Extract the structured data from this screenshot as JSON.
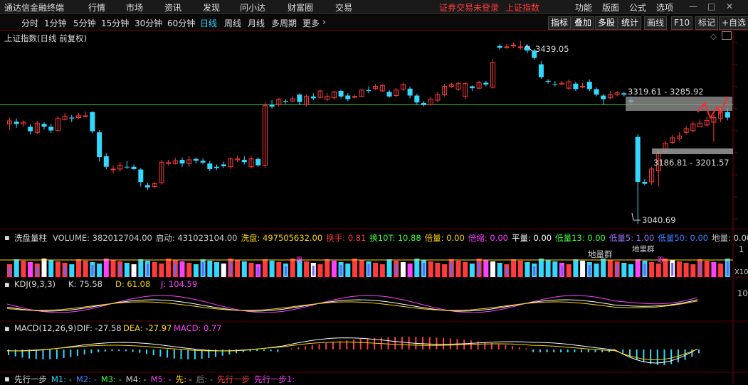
{
  "menubar": {
    "app_title": "通达信金融终端",
    "items": [
      "行情",
      "市场",
      "资讯",
      "发现",
      "问小达",
      "财富圈",
      "交易"
    ],
    "notice": "证券交易未登录",
    "current_index": "上证指数",
    "right_items": [
      "功能",
      "版面",
      "公式",
      "选项"
    ]
  },
  "toolbar": {
    "timeframes": [
      "分时",
      "1分钟",
      "5分钟",
      "15分钟",
      "30分钟",
      "60分钟",
      "日线",
      "周线",
      "月线",
      "多周期",
      "更多"
    ],
    "active": "日线",
    "tools": [
      "指标",
      "叠加",
      "多股",
      "统计",
      "画线",
      "F10",
      "标记",
      "+自选"
    ],
    "active_tools": [
      "指标",
      "叠加",
      "多股",
      "统计"
    ]
  },
  "main_chart": {
    "title": "上证指数(日线 前复权)",
    "annotations": {
      "high": "3439.05",
      "range_upper": "3319.61 - 3285.92",
      "range_lower": "3186.81 - 3201.57",
      "low": "3040.69"
    }
  },
  "volume_panel": {
    "indicator": "洗盘量柱",
    "fields": [
      {
        "text": "VOLUME: 382012704.00",
        "color": "#cccccc"
      },
      {
        "text": "启动: 431023104.00",
        "color": "#cccccc"
      },
      {
        "text": "洗盘: 497505632.00",
        "color": "#ffd700"
      },
      {
        "text": "换手: 0.81",
        "color": "#ff3b3b"
      },
      {
        "text": "换10T: 10.88",
        "color": "#3bff3b"
      },
      {
        "text": "倍量: 0.00",
        "color": "#ffd700"
      },
      {
        "text": "倍缩: 0.00",
        "color": "#ff40ff"
      },
      {
        "text": "平量: 0.00",
        "color": "#ffffff"
      },
      {
        "text": "低量13: 0.00",
        "color": "#3bff3b"
      },
      {
        "text": "低量5: 1.00",
        "color": "#a070ff"
      },
      {
        "text": "低量50: 0.00",
        "color": "#4080ff"
      },
      {
        "text": "地量: 0.00",
        "color": "#cccccc"
      },
      {
        "text": "地",
        "color": "#a070ff"
      }
    ],
    "labels": {
      "digeqiao_1": "地量群",
      "digeqiao_2": "地里群",
      "small_tag": "跟"
    },
    "axis": {
      "top": "1",
      "bottom": "X10"
    }
  },
  "kdj_panel": {
    "name": "KDJ(9,3,3)",
    "k": "K: 75.58",
    "d": "D: 61.08",
    "j": "J: 104.59",
    "axis": {
      "top": "10"
    }
  },
  "macd_panel": {
    "name": "MACD(12,26,9)",
    "dif": "DIF: -27.58",
    "dea": "DEA: -27.97",
    "macd": "MACD: 0.77"
  },
  "bottom_panel": {
    "name": "先行一步",
    "fields": [
      {
        "text": "M1: -",
        "color": "#34d8ff"
      },
      {
        "text": "M2: -",
        "color": "#4080ff"
      },
      {
        "text": "M3: -",
        "color": "#3bff3b"
      },
      {
        "text": "M4: -",
        "color": "#cccccc"
      },
      {
        "text": "M5: -",
        "color": "#ff40ff"
      },
      {
        "text": "先: -",
        "color": "#ffd700"
      },
      {
        "text": "后: -",
        "color": "#888888"
      },
      {
        "text": "先行一步",
        "color": "#ff3b3b"
      },
      {
        "text": "先行一步1:",
        "color": "#ff40ff"
      }
    ]
  },
  "colors": {
    "up": "#ff3b3b",
    "down": "#34d8ff",
    "bg": "#000000",
    "grid": "#7a0000",
    "ma_line": "#2eb82e"
  },
  "chart_data": {
    "type": "candlestick",
    "ylim": [
      3030,
      3460
    ],
    "reference_line": 3300,
    "candles": [
      [
        3258,
        3265,
        3245,
        3272
      ],
      [
        3263,
        3258,
        3250,
        3270
      ],
      [
        3258,
        3262,
        3252,
        3266
      ],
      [
        3252,
        3242,
        3235,
        3258
      ],
      [
        3240,
        3260,
        3236,
        3265
      ],
      [
        3258,
        3252,
        3246,
        3262
      ],
      [
        3252,
        3244,
        3238,
        3258
      ],
      [
        3244,
        3270,
        3242,
        3275
      ],
      [
        3268,
        3275,
        3266,
        3282
      ],
      [
        3272,
        3270,
        3262,
        3278
      ],
      [
        3272,
        3276,
        3268,
        3282
      ],
      [
        3275,
        3276,
        3272,
        3285
      ],
      [
        3284,
        3242,
        3238,
        3286
      ],
      [
        3240,
        3186,
        3176,
        3245
      ],
      [
        3188,
        3165,
        3160,
        3195
      ],
      [
        3160,
        3160,
        3150,
        3168
      ],
      [
        3160,
        3168,
        3154,
        3175
      ],
      [
        3165,
        3164,
        3160,
        3178
      ],
      [
        3165,
        3160,
        3158,
        3170
      ],
      [
        3159,
        3132,
        3122,
        3162
      ],
      [
        3125,
        3120,
        3114,
        3130
      ],
      [
        3122,
        3128,
        3118,
        3132
      ],
      [
        3130,
        3175,
        3126,
        3180
      ],
      [
        3172,
        3174,
        3168,
        3180
      ],
      [
        3172,
        3178,
        3170,
        3185
      ],
      [
        3180,
        3172,
        3165,
        3185
      ],
      [
        3172,
        3180,
        3165,
        3188
      ],
      [
        3182,
        3178,
        3172,
        3185
      ],
      [
        3178,
        3174,
        3170,
        3183
      ],
      [
        3172,
        3160,
        3155,
        3178
      ],
      [
        3165,
        3162,
        3158,
        3170
      ],
      [
        3170,
        3166,
        3162,
        3176
      ],
      [
        3165,
        3182,
        3160,
        3185
      ],
      [
        3180,
        3182,
        3175,
        3190
      ],
      [
        3180,
        3175,
        3170,
        3188
      ],
      [
        3165,
        3182,
        3162,
        3188
      ],
      [
        3182,
        3168,
        3165,
        3185
      ],
      [
        3168,
        3298,
        3162,
        3305
      ],
      [
        3300,
        3296,
        3292,
        3310
      ],
      [
        3300,
        3312,
        3296,
        3315
      ],
      [
        3308,
        3306,
        3302,
        3312
      ],
      [
        3308,
        3313,
        3305,
        3318
      ],
      [
        3322,
        3306,
        3300,
        3325
      ],
      [
        3300,
        3318,
        3296,
        3322
      ],
      [
        3318,
        3314,
        3310,
        3325
      ],
      [
        3316,
        3330,
        3314,
        3333
      ],
      [
        3312,
        3318,
        3308,
        3325
      ],
      [
        3315,
        3328,
        3312,
        3330
      ],
      [
        3330,
        3318,
        3314,
        3333
      ],
      [
        3320,
        3312,
        3308,
        3325
      ],
      [
        3318,
        3318,
        3314,
        3322
      ],
      [
        3318,
        3332,
        3316,
        3335
      ],
      [
        3332,
        3330,
        3325,
        3340
      ],
      [
        3335,
        3340,
        3332,
        3345
      ],
      [
        3330,
        3342,
        3328,
        3345
      ],
      [
        3328,
        3318,
        3315,
        3332
      ],
      [
        3320,
        3332,
        3316,
        3336
      ],
      [
        3334,
        3344,
        3330,
        3348
      ],
      [
        3335,
        3320,
        3314,
        3340
      ],
      [
        3320,
        3305,
        3300,
        3324
      ],
      [
        3304,
        3300,
        3296,
        3308
      ],
      [
        3300,
        3312,
        3298,
        3318
      ],
      [
        3310,
        3322,
        3305,
        3328
      ],
      [
        3322,
        3340,
        3318,
        3345
      ],
      [
        3340,
        3344,
        3336,
        3348
      ],
      [
        3334,
        3346,
        3330,
        3350
      ],
      [
        3318,
        3346,
        3312,
        3350
      ],
      [
        3340,
        3336,
        3330,
        3342
      ],
      [
        3336,
        3348,
        3334,
        3352
      ],
      [
        3348,
        3344,
        3340,
        3352
      ],
      [
        3338,
        3392,
        3335,
        3400
      ],
      [
        3428,
        3424,
        3420,
        3432
      ],
      [
        3426,
        3426,
        3422,
        3432
      ],
      [
        3428,
        3430,
        3424,
        3436
      ],
      [
        3426,
        3426,
        3420,
        3439
      ],
      [
        3428,
        3418,
        3412,
        3432
      ],
      [
        3418,
        3402,
        3398,
        3422
      ],
      [
        3388,
        3360,
        3356,
        3395
      ],
      [
        3352,
        3350,
        3346,
        3356
      ],
      [
        3345,
        3344,
        3340,
        3352
      ],
      [
        3345,
        3347,
        3342,
        3352
      ],
      [
        3336,
        3350,
        3332,
        3355
      ],
      [
        3346,
        3334,
        3330,
        3350
      ],
      [
        3340,
        3340,
        3336,
        3348
      ],
      [
        3350,
        3334,
        3330,
        3355
      ],
      [
        3334,
        3322,
        3318,
        3338
      ],
      [
        3320,
        3312,
        3300,
        3324
      ],
      [
        3315,
        3322,
        3312,
        3330
      ],
      [
        3322,
        3326,
        3318,
        3330
      ],
      [
        3325,
        3322,
        3318,
        3328
      ],
      [
        3310,
        3306,
        3300,
        3318
      ],
      [
        3230,
        3132,
        3040,
        3236
      ],
      [
        3132,
        3128,
        3124,
        3138
      ],
      [
        3132,
        3160,
        3126,
        3165
      ],
      [
        3156,
        3194,
        3122,
        3200
      ],
      [
        3198,
        3216,
        3196,
        3222
      ],
      [
        3218,
        3228,
        3214,
        3234
      ],
      [
        3226,
        3232,
        3222,
        3240
      ],
      [
        3240,
        3248,
        3236,
        3254
      ],
      [
        3244,
        3258,
        3240,
        3264
      ],
      [
        3252,
        3260,
        3256,
        3268
      ],
      [
        3256,
        3266,
        3252,
        3274
      ],
      [
        3262,
        3272,
        3220,
        3278
      ],
      [
        3270,
        3284,
        3262,
        3292
      ],
      [
        3284,
        3272,
        3266,
        3292
      ]
    ]
  }
}
